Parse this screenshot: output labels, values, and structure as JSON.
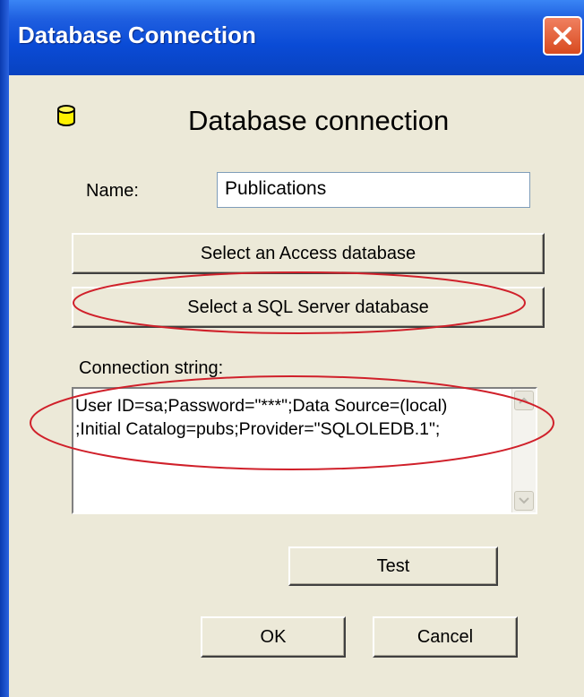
{
  "window": {
    "title": "Database Connection"
  },
  "icons": {
    "database": "database-icon",
    "close": "close-icon"
  },
  "header": {
    "heading": "Database connection"
  },
  "form": {
    "name_label": "Name:",
    "name_value": "Publications",
    "access_button_label": "Select an Access database",
    "sql_button_label": "Select a SQL Server database",
    "connection_label": "Connection string:",
    "connection_value": "User ID=sa;Password=\"***\";Data Source=(local)\n;Initial Catalog=pubs;Provider=\"SQLOLEDB.1\";"
  },
  "buttons": {
    "test": "Test",
    "ok": "OK",
    "cancel": "Cancel"
  },
  "colors": {
    "titlebar": "#0A4BD6",
    "close": "#D84A1F",
    "highlight_ellipse": "#D0202A",
    "dialog_bg": "#ECE9D8"
  }
}
